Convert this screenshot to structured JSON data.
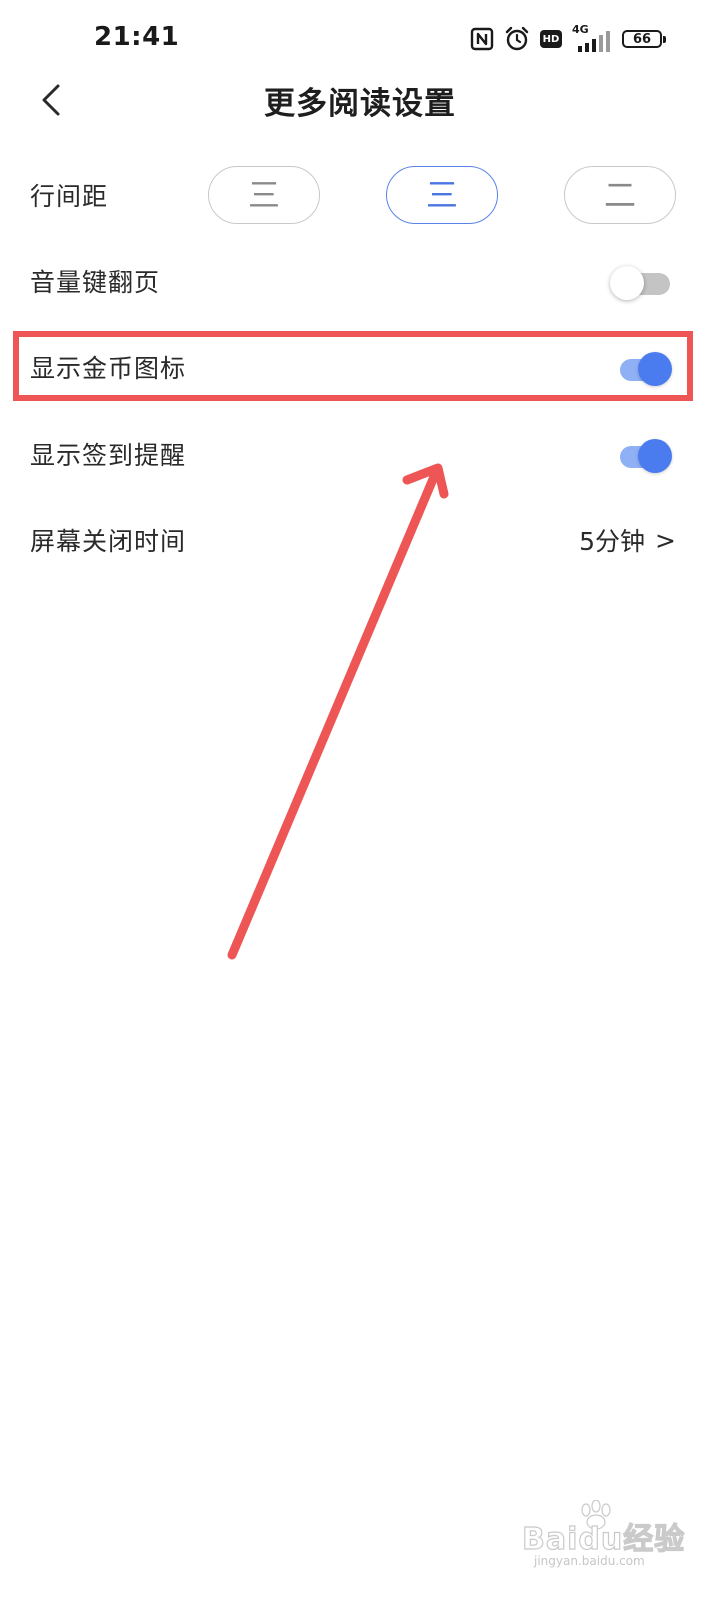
{
  "status_bar": {
    "time": "21:41",
    "hd_label": "HD",
    "network_label": "4G",
    "battery_level": "66",
    "icons": [
      "nfc-icon",
      "alarm-icon",
      "hd-icon",
      "signal-icon",
      "battery-icon"
    ]
  },
  "header": {
    "back_icon": "chevron-left-icon",
    "title": "更多阅读设置"
  },
  "settings": {
    "line_spacing": {
      "label": "行间距",
      "options": [
        {
          "glyph": "三",
          "selected": false
        },
        {
          "glyph": "三",
          "selected": true
        },
        {
          "glyph": "二",
          "selected": false
        }
      ]
    },
    "volume_page_turn": {
      "label": "音量键翻页",
      "enabled": false
    },
    "show_coin_icon": {
      "label": "显示金币图标",
      "enabled": true
    },
    "show_checkin_reminder": {
      "label": "显示签到提醒",
      "enabled": true
    },
    "screen_off_time": {
      "label": "屏幕关闭时间",
      "value": "5分钟",
      "chevron": ">"
    }
  },
  "annotation": {
    "highlight_color": "#ee5555",
    "arrow_color": "#ee5555"
  },
  "colors": {
    "accent": "#4a7cf0",
    "toggle_track_on": "#8fb0f5",
    "toggle_track_off": "#c4c4c4"
  },
  "watermark": {
    "main": "Baidu经验",
    "sub": "jingyan.baidu.com"
  }
}
